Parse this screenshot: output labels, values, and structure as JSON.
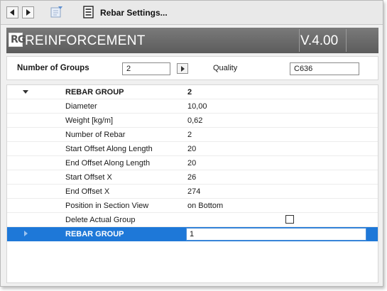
{
  "toolbar": {
    "title": "Rebar Settings..."
  },
  "banner": {
    "logo_text": "RG",
    "title": "REINFORCEMENT",
    "version": "V.4.00"
  },
  "groups": {
    "label": "Number of Groups",
    "value": "2",
    "quality_label": "Quality",
    "quality_value": "C636"
  },
  "grid": {
    "group_header": {
      "label": "REBAR GROUP",
      "value": "2"
    },
    "rows": [
      {
        "label": "Diameter",
        "value": "10,00"
      },
      {
        "label": "Weight [kg/m]",
        "value": "0,62"
      },
      {
        "label": "Number of Rebar",
        "value": "2"
      },
      {
        "label": "Start Offset Along Length",
        "value": "20"
      },
      {
        "label": "End Offset Along Length",
        "value": "20"
      },
      {
        "label": "Start Offset X",
        "value": "26"
      },
      {
        "label": "End Offset X",
        "value": "274"
      },
      {
        "label": "Position in Section View",
        "value": "on Bottom"
      },
      {
        "label": "Delete Actual Group",
        "value": ""
      }
    ],
    "selected_group": {
      "label": "REBAR GROUP",
      "value": "1"
    }
  },
  "colors": {
    "selection": "#1e78d8",
    "banner": "#666666"
  }
}
